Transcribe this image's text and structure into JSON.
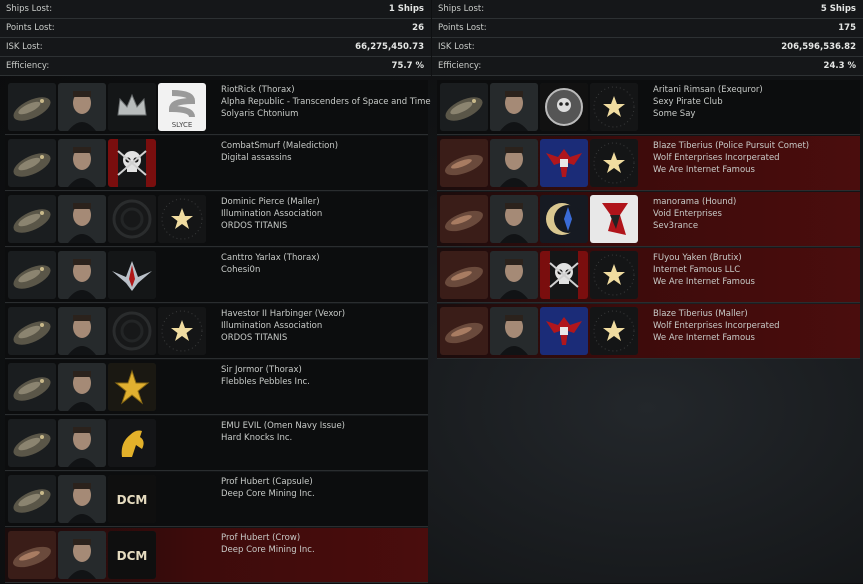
{
  "left": {
    "stats": [
      {
        "label": "Ships Lost:",
        "value": "1 Ships"
      },
      {
        "label": "Points Lost:",
        "value": "26"
      },
      {
        "label": "ISK Lost:",
        "value": "66,275,450.73"
      },
      {
        "label": "Efficiency:",
        "value": "75.7 %"
      }
    ],
    "rows": [
      {
        "pilot": "RiotRick (Thorax)",
        "corp": "Alpha Republic - Transcenders of Space and Time",
        "alliance": "Solyaris Chtonium",
        "red": false,
        "corp_logo": "crown-logo",
        "alliance_logo": "slyce-logo",
        "alliance_logo_text": "SLYCE"
      },
      {
        "pilot": "CombatSmurf (Malediction)",
        "corp": "Digital assassins",
        "alliance": "",
        "red": false,
        "corp_logo": "skull-logo",
        "alliance_logo": ""
      },
      {
        "pilot": "Dominic Pierce (Maller)",
        "corp": "Illumination Association",
        "alliance": "ORDOS TITANIS",
        "red": false,
        "corp_logo": "circle-logo",
        "alliance_logo": "star-logo"
      },
      {
        "pilot": "Canttro Yarlax (Thorax)",
        "corp": "Cohesi0n",
        "alliance": "",
        "red": false,
        "corp_logo": "wings-logo",
        "alliance_logo": ""
      },
      {
        "pilot": "Havestor II Harbinger (Vexor)",
        "corp": "Illumination Association",
        "alliance": "ORDOS TITANIS",
        "red": false,
        "corp_logo": "circle-logo",
        "alliance_logo": "star-logo"
      },
      {
        "pilot": "Sir Jormor (Thorax)",
        "corp": "Flebbles Pebbles Inc.",
        "alliance": "",
        "red": false,
        "corp_logo": "gold-star-logo",
        "alliance_logo": ""
      },
      {
        "pilot": "EMU EVIL (Omen Navy Issue)",
        "corp": "Hard Knocks Inc.",
        "alliance": "",
        "red": false,
        "corp_logo": "horse-logo",
        "alliance_logo": ""
      },
      {
        "pilot": "Prof Hubert (Capsule)",
        "corp": "Deep Core Mining Inc.",
        "alliance": "",
        "red": false,
        "corp_logo": "dcm-logo",
        "corp_logo_text": "DCM",
        "alliance_logo": ""
      },
      {
        "pilot": "Prof Hubert (Crow)",
        "corp": "Deep Core Mining Inc.",
        "alliance": "",
        "red": true,
        "corp_logo": "dcm-logo",
        "corp_logo_text": "DCM",
        "alliance_logo": ""
      }
    ]
  },
  "right": {
    "stats": [
      {
        "label": "Ships Lost:",
        "value": "5 Ships"
      },
      {
        "label": "Points Lost:",
        "value": "175"
      },
      {
        "label": "ISK Lost:",
        "value": "206,596,536.82"
      },
      {
        "label": "Efficiency:",
        "value": "24.3 %"
      }
    ],
    "rows": [
      {
        "pilot": "Aritani Rimsan (Exequror)",
        "corp": "Sexy Pirate Club",
        "alliance": "Some Say",
        "red": false,
        "corp_logo": "skull-medal-logo",
        "alliance_logo": "star-logo"
      },
      {
        "pilot": "Blaze Tiberius (Police Pursuit Comet)",
        "corp": "Wolf Enterprises Incorperated",
        "alliance": "We Are Internet Famous",
        "red": true,
        "corp_logo": "eagle-logo",
        "alliance_logo": "star-logo"
      },
      {
        "pilot": "manorama (Hound)",
        "corp": "Void Enterprises",
        "alliance": "Sev3rance",
        "red": true,
        "corp_logo": "crescent-logo",
        "alliance_logo": "dragon-logo"
      },
      {
        "pilot": "FUyou Yaken (Brutix)",
        "corp": "Internet Famous LLC",
        "alliance": "We Are Internet Famous",
        "red": true,
        "corp_logo": "skull-logo",
        "alliance_logo": "star-logo"
      },
      {
        "pilot": "Blaze Tiberius (Maller)",
        "corp": "Wolf Enterprises Incorperated",
        "alliance": "We Are Internet Famous",
        "red": true,
        "corp_logo": "eagle-logo",
        "alliance_logo": "star-logo"
      }
    ]
  },
  "colors": {
    "loss_row": "#4a0d0d",
    "panel": "#151719",
    "text": "#c9ccc9"
  }
}
